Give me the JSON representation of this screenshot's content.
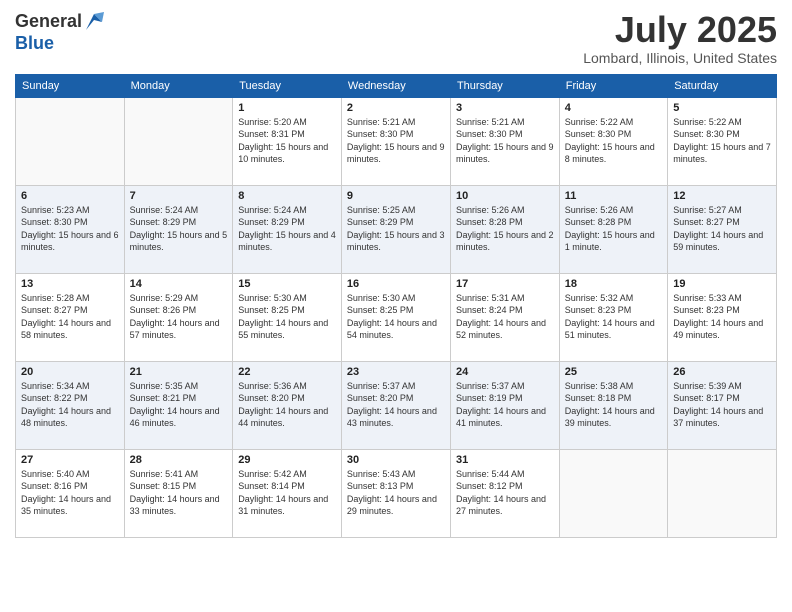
{
  "logo": {
    "general": "General",
    "blue": "Blue"
  },
  "title": "July 2025",
  "location": "Lombard, Illinois, United States",
  "days_of_week": [
    "Sunday",
    "Monday",
    "Tuesday",
    "Wednesday",
    "Thursday",
    "Friday",
    "Saturday"
  ],
  "weeks": [
    [
      {
        "day": "",
        "sunrise": "",
        "sunset": "",
        "daylight": ""
      },
      {
        "day": "",
        "sunrise": "",
        "sunset": "",
        "daylight": ""
      },
      {
        "day": "1",
        "sunrise": "Sunrise: 5:20 AM",
        "sunset": "Sunset: 8:31 PM",
        "daylight": "Daylight: 15 hours and 10 minutes."
      },
      {
        "day": "2",
        "sunrise": "Sunrise: 5:21 AM",
        "sunset": "Sunset: 8:30 PM",
        "daylight": "Daylight: 15 hours and 9 minutes."
      },
      {
        "day": "3",
        "sunrise": "Sunrise: 5:21 AM",
        "sunset": "Sunset: 8:30 PM",
        "daylight": "Daylight: 15 hours and 9 minutes."
      },
      {
        "day": "4",
        "sunrise": "Sunrise: 5:22 AM",
        "sunset": "Sunset: 8:30 PM",
        "daylight": "Daylight: 15 hours and 8 minutes."
      },
      {
        "day": "5",
        "sunrise": "Sunrise: 5:22 AM",
        "sunset": "Sunset: 8:30 PM",
        "daylight": "Daylight: 15 hours and 7 minutes."
      }
    ],
    [
      {
        "day": "6",
        "sunrise": "Sunrise: 5:23 AM",
        "sunset": "Sunset: 8:30 PM",
        "daylight": "Daylight: 15 hours and 6 minutes."
      },
      {
        "day": "7",
        "sunrise": "Sunrise: 5:24 AM",
        "sunset": "Sunset: 8:29 PM",
        "daylight": "Daylight: 15 hours and 5 minutes."
      },
      {
        "day": "8",
        "sunrise": "Sunrise: 5:24 AM",
        "sunset": "Sunset: 8:29 PM",
        "daylight": "Daylight: 15 hours and 4 minutes."
      },
      {
        "day": "9",
        "sunrise": "Sunrise: 5:25 AM",
        "sunset": "Sunset: 8:29 PM",
        "daylight": "Daylight: 15 hours and 3 minutes."
      },
      {
        "day": "10",
        "sunrise": "Sunrise: 5:26 AM",
        "sunset": "Sunset: 8:28 PM",
        "daylight": "Daylight: 15 hours and 2 minutes."
      },
      {
        "day": "11",
        "sunrise": "Sunrise: 5:26 AM",
        "sunset": "Sunset: 8:28 PM",
        "daylight": "Daylight: 15 hours and 1 minute."
      },
      {
        "day": "12",
        "sunrise": "Sunrise: 5:27 AM",
        "sunset": "Sunset: 8:27 PM",
        "daylight": "Daylight: 14 hours and 59 minutes."
      }
    ],
    [
      {
        "day": "13",
        "sunrise": "Sunrise: 5:28 AM",
        "sunset": "Sunset: 8:27 PM",
        "daylight": "Daylight: 14 hours and 58 minutes."
      },
      {
        "day": "14",
        "sunrise": "Sunrise: 5:29 AM",
        "sunset": "Sunset: 8:26 PM",
        "daylight": "Daylight: 14 hours and 57 minutes."
      },
      {
        "day": "15",
        "sunrise": "Sunrise: 5:30 AM",
        "sunset": "Sunset: 8:25 PM",
        "daylight": "Daylight: 14 hours and 55 minutes."
      },
      {
        "day": "16",
        "sunrise": "Sunrise: 5:30 AM",
        "sunset": "Sunset: 8:25 PM",
        "daylight": "Daylight: 14 hours and 54 minutes."
      },
      {
        "day": "17",
        "sunrise": "Sunrise: 5:31 AM",
        "sunset": "Sunset: 8:24 PM",
        "daylight": "Daylight: 14 hours and 52 minutes."
      },
      {
        "day": "18",
        "sunrise": "Sunrise: 5:32 AM",
        "sunset": "Sunset: 8:23 PM",
        "daylight": "Daylight: 14 hours and 51 minutes."
      },
      {
        "day": "19",
        "sunrise": "Sunrise: 5:33 AM",
        "sunset": "Sunset: 8:23 PM",
        "daylight": "Daylight: 14 hours and 49 minutes."
      }
    ],
    [
      {
        "day": "20",
        "sunrise": "Sunrise: 5:34 AM",
        "sunset": "Sunset: 8:22 PM",
        "daylight": "Daylight: 14 hours and 48 minutes."
      },
      {
        "day": "21",
        "sunrise": "Sunrise: 5:35 AM",
        "sunset": "Sunset: 8:21 PM",
        "daylight": "Daylight: 14 hours and 46 minutes."
      },
      {
        "day": "22",
        "sunrise": "Sunrise: 5:36 AM",
        "sunset": "Sunset: 8:20 PM",
        "daylight": "Daylight: 14 hours and 44 minutes."
      },
      {
        "day": "23",
        "sunrise": "Sunrise: 5:37 AM",
        "sunset": "Sunset: 8:20 PM",
        "daylight": "Daylight: 14 hours and 43 minutes."
      },
      {
        "day": "24",
        "sunrise": "Sunrise: 5:37 AM",
        "sunset": "Sunset: 8:19 PM",
        "daylight": "Daylight: 14 hours and 41 minutes."
      },
      {
        "day": "25",
        "sunrise": "Sunrise: 5:38 AM",
        "sunset": "Sunset: 8:18 PM",
        "daylight": "Daylight: 14 hours and 39 minutes."
      },
      {
        "day": "26",
        "sunrise": "Sunrise: 5:39 AM",
        "sunset": "Sunset: 8:17 PM",
        "daylight": "Daylight: 14 hours and 37 minutes."
      }
    ],
    [
      {
        "day": "27",
        "sunrise": "Sunrise: 5:40 AM",
        "sunset": "Sunset: 8:16 PM",
        "daylight": "Daylight: 14 hours and 35 minutes."
      },
      {
        "day": "28",
        "sunrise": "Sunrise: 5:41 AM",
        "sunset": "Sunset: 8:15 PM",
        "daylight": "Daylight: 14 hours and 33 minutes."
      },
      {
        "day": "29",
        "sunrise": "Sunrise: 5:42 AM",
        "sunset": "Sunset: 8:14 PM",
        "daylight": "Daylight: 14 hours and 31 minutes."
      },
      {
        "day": "30",
        "sunrise": "Sunrise: 5:43 AM",
        "sunset": "Sunset: 8:13 PM",
        "daylight": "Daylight: 14 hours and 29 minutes."
      },
      {
        "day": "31",
        "sunrise": "Sunrise: 5:44 AM",
        "sunset": "Sunset: 8:12 PM",
        "daylight": "Daylight: 14 hours and 27 minutes."
      },
      {
        "day": "",
        "sunrise": "",
        "sunset": "",
        "daylight": ""
      },
      {
        "day": "",
        "sunrise": "",
        "sunset": "",
        "daylight": ""
      }
    ]
  ]
}
